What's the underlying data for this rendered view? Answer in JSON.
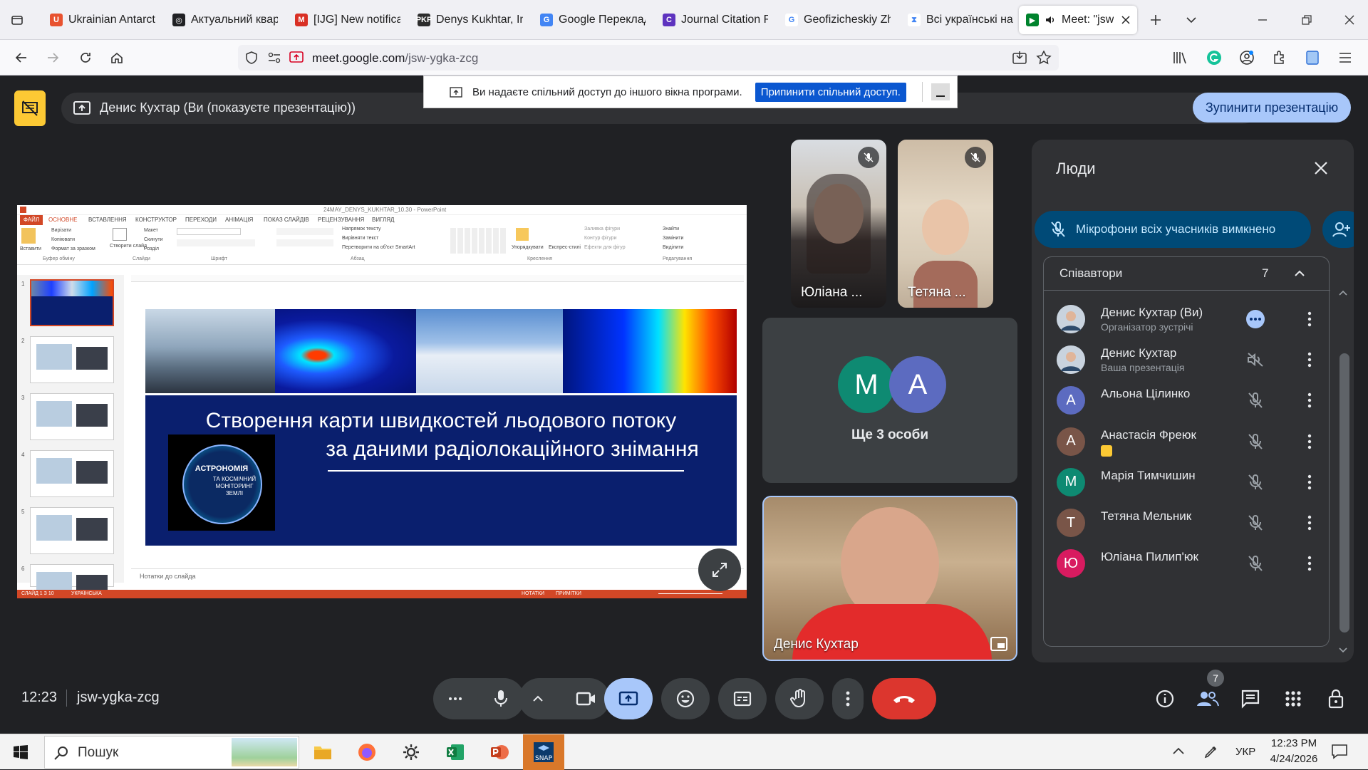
{
  "browser": {
    "tabs": [
      {
        "label": "Ukrainian Antarcti",
        "icon": "ukr-antarctic-icon",
        "color": "#e8522f",
        "glyph": "U"
      },
      {
        "label": "Актуальний квар",
        "icon": "openai-icon",
        "color": "#202124",
        "glyph": "◎"
      },
      {
        "label": "[IJG] New notificati",
        "icon": "gmail-icon",
        "color": "#d93025",
        "glyph": "M"
      },
      {
        "label": "Denys Kukhtar, In",
        "icon": "pkp-icon",
        "color": "#2c2c2c",
        "glyph": "PKP"
      },
      {
        "label": "Google Переклад",
        "icon": "google-translate-icon",
        "color": "#4285f4",
        "glyph": "G"
      },
      {
        "label": "Journal Citation R",
        "icon": "clarivate-icon",
        "color": "#5e33bf",
        "glyph": "C"
      },
      {
        "label": "Geofizicheskiy Zh",
        "icon": "google-icon",
        "color": "#ffffff",
        "glyph": "G"
      },
      {
        "label": "Всі українські нау",
        "icon": "hourglass-icon",
        "color": "#ffffff",
        "glyph": "⧗"
      },
      {
        "label": "Meet: \"jsw",
        "icon": "google-meet-icon",
        "color": "#00832d",
        "glyph": "▶"
      }
    ],
    "url_domain": "meet.google.com",
    "url_path": "/jsw-ygka-zcg"
  },
  "share_notice": {
    "text": "Ви надаєте спільний доступ до іншого вікна програми.",
    "stop_label": "Припинити спільний доступ."
  },
  "presentation_bar": {
    "label": "Денис Кухтар (Ви (показуєте презентацію))",
    "stop_button": "Зупинити презентацію"
  },
  "ppt": {
    "title": "24MAY_DENYS_KUKHTAR_10.30 - PowerPoint",
    "ribbon_tabs": [
      "ФАЙЛ",
      "ОСНОВНЕ",
      "ВСТАВЛЕННЯ",
      "КОНСТРУКТОР",
      "ПЕРЕХОДИ",
      "АНІМАЦІЯ",
      "ПОКАЗ СЛАЙДІВ",
      "РЕЦЕНЗУВАННЯ",
      "ВИГЛЯД"
    ],
    "ribbon_groups": [
      "Буфер обміну",
      "Слайди",
      "Шрифт",
      "Абзац",
      "Креслення",
      "Редагування"
    ],
    "clipboard": {
      "paste": "Вставити",
      "cut": "Вирізати",
      "copy": "Копіювати",
      "format": "Формат за зразком"
    },
    "slides_group": {
      "new": "Створити слайд",
      "layout": "Макет",
      "reset": "Скинути",
      "section": "Розділ"
    },
    "paragraph_items": [
      "Напрямок тексту",
      "Вирівняти текст",
      "Перетворити на об'єкт SmartArt"
    ],
    "drawing_items": [
      "Упорядкувати",
      "Експрес-стилі",
      "Заливка фігури",
      "Контур фігури",
      "Ефекти для фігур"
    ],
    "editing_items": [
      "Знайти",
      "Замінити",
      "Виділити"
    ],
    "slide_numbers": [
      "1",
      "2",
      "3",
      "4",
      "5",
      "6"
    ],
    "slide_title_line1": "Створення карти швидкостей льодового потоку",
    "slide_title_line2": "за даними радіолокаційного знімання",
    "logo_line1": "АСТРОНОМІЯ",
    "logo_line2": "ТА КОСМІЧНИЙ",
    "logo_line3": "МОНІТОРИНГ",
    "logo_line4": "ЗЕМЛІ",
    "notes_placeholder": "Нотатки до слайда",
    "status_left": "СЛАЙД 1 З 10",
    "status_lang": "УКРАЇНСЬКА",
    "status_notes": "НОТАТКИ",
    "status_comments": "ПРИМІТКИ",
    "colors": {
      "ribbon": "#d24726",
      "slide_bg": "#0a1f6e"
    }
  },
  "tiles": {
    "p1": "Юліана ...",
    "p2": "Тетяна ...",
    "others_label": "Ще 3 особи",
    "others_avatars": [
      {
        "letter": "M",
        "color": "#0e8a72"
      },
      {
        "letter": "A",
        "color": "#5c6bc0"
      }
    ],
    "self": "Денис Кухтар"
  },
  "people_panel": {
    "title": "Люди",
    "mute_all": "Мікрофони всіх учасників вимкнено",
    "section": "Співавтори",
    "count": "7",
    "rows": [
      {
        "name": "Денис Кухтар (Ви)",
        "sub": "Організатор зустрічі",
        "letter": "",
        "color": "#6b7b8c",
        "status": "more-dots-icon"
      },
      {
        "name": "Денис Кухтар",
        "sub": "Ваша презентація",
        "letter": "",
        "color": "#6b7b8c",
        "status": "volume-off-icon"
      },
      {
        "name": "Альона Цілинко",
        "sub": "",
        "letter": "А",
        "color": "#5c6bc0",
        "status": "mic-off-icon"
      },
      {
        "name": "Анастасія Фреюк",
        "sub": "",
        "letter": "А",
        "color": "#795548",
        "status": "mic-off-icon"
      },
      {
        "name": "Марія Тимчишин",
        "sub": "",
        "letter": "М",
        "color": "#0e8a72",
        "status": "mic-off-icon"
      },
      {
        "name": "Тетяна Мельник",
        "sub": "",
        "letter": "Т",
        "color": "#795548",
        "status": "mic-off-icon"
      },
      {
        "name": "Юліана Пилип'юк",
        "sub": "",
        "letter": "Ю",
        "color": "#d81b60",
        "status": "mic-off-icon"
      }
    ]
  },
  "bottom": {
    "time": "12:23",
    "code": "jsw-ygka-zcg",
    "people_badge": "7"
  },
  "taskbar": {
    "search": "Пошук",
    "lang": "УКР",
    "time": "12:23 PM",
    "date": "4/24/2026"
  }
}
